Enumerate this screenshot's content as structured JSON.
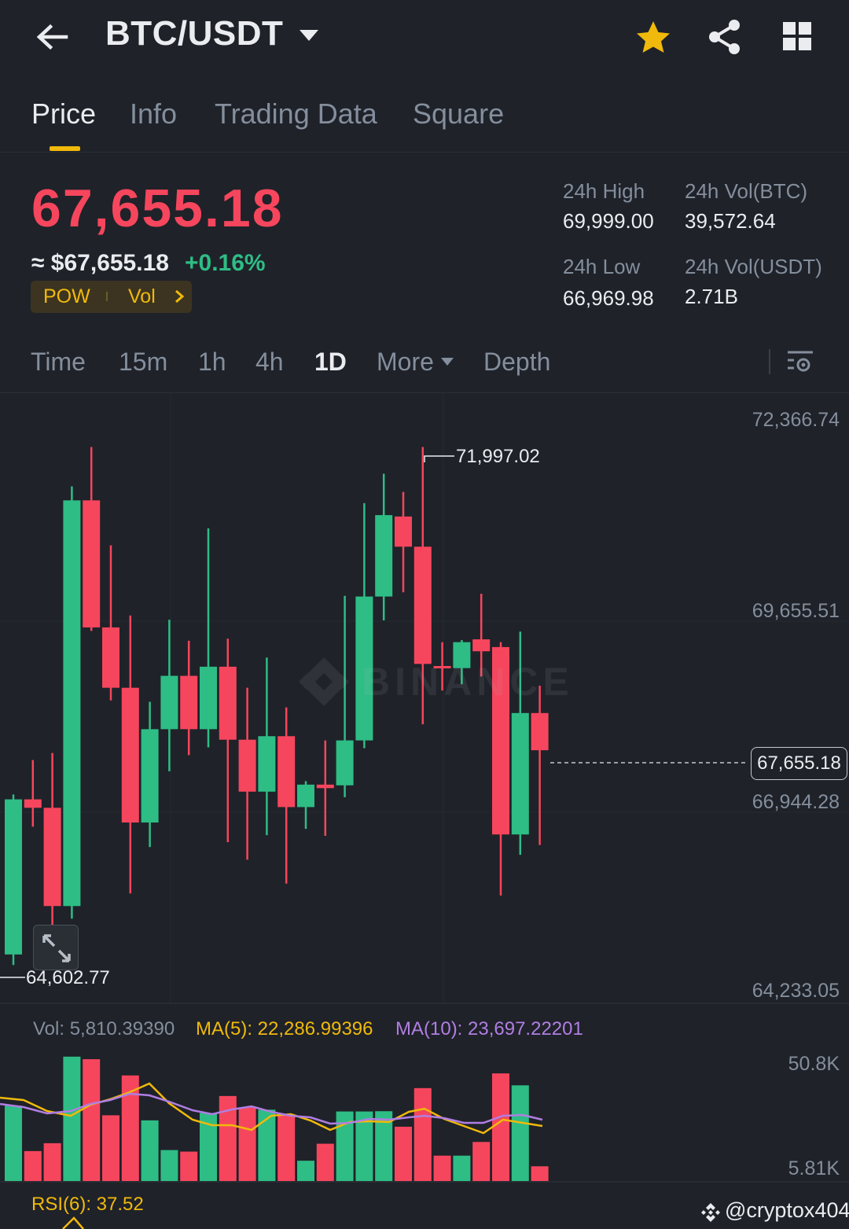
{
  "header": {
    "pair": "BTC/USDT"
  },
  "tabs": [
    "Price",
    "Info",
    "Trading Data",
    "Square"
  ],
  "ticker": {
    "last_price": "67,655.18",
    "fiat_price": "≈ $67,655.18",
    "change_pct": "+0.16%",
    "tag_pow": "POW",
    "tag_vol": "Vol",
    "high_label": "24h High",
    "high_value": "69,999.00",
    "low_label": "24h Low",
    "low_value": "66,969.98",
    "vol_btc_label": "24h Vol(BTC)",
    "vol_btc_value": "39,572.64",
    "vol_usdt_label": "24h Vol(USDT)",
    "vol_usdt_value": "2.71B"
  },
  "intervals": [
    "Time",
    "15m",
    "1h",
    "4h",
    "1D",
    "More",
    "Depth"
  ],
  "chart": {
    "watermark": "BINANCE",
    "axis_labels": [
      "72,366.74",
      "69,655.51",
      "66,944.28",
      "64,233.05"
    ],
    "highest_marker": "71,997.02",
    "lowest_marker": "64,602.77",
    "current_price": "67,655.18"
  },
  "volume": {
    "vol_label": "Vol: 5,810.39390",
    "ma5_label": "MA(5): 22,286.99396",
    "ma10_label": "MA(10): 23,697.22201",
    "axis_top": "50.8K",
    "axis_bottom": "5.81K"
  },
  "rsi": {
    "label": "RSI(6): 37.52"
  },
  "credit": "@cryptox404",
  "colors": {
    "up": "#2ebd85",
    "down": "#f6465d",
    "accent": "#f0b90b",
    "ma10": "#b07ee3"
  },
  "chart_data": {
    "type": "candlestick",
    "y_range": [
      64233.05,
      72366.74
    ],
    "candles": [
      {
        "o": 64750,
        "h": 67030,
        "l": 64600,
        "c": 66960,
        "dir": "up"
      },
      {
        "o": 66960,
        "h": 67520,
        "l": 66570,
        "c": 66840,
        "dir": "down"
      },
      {
        "o": 66840,
        "h": 67620,
        "l": 65130,
        "c": 65440,
        "dir": "down"
      },
      {
        "o": 65440,
        "h": 71420,
        "l": 65260,
        "c": 71220,
        "dir": "up"
      },
      {
        "o": 71220,
        "h": 71980,
        "l": 69360,
        "c": 69410,
        "dir": "down"
      },
      {
        "o": 69410,
        "h": 70580,
        "l": 68370,
        "c": 68550,
        "dir": "down"
      },
      {
        "o": 68550,
        "h": 69580,
        "l": 65620,
        "c": 66630,
        "dir": "down"
      },
      {
        "o": 66630,
        "h": 68350,
        "l": 66280,
        "c": 67960,
        "dir": "up"
      },
      {
        "o": 67960,
        "h": 69520,
        "l": 67360,
        "c": 68720,
        "dir": "up"
      },
      {
        "o": 68720,
        "h": 69220,
        "l": 67590,
        "c": 67960,
        "dir": "down"
      },
      {
        "o": 67960,
        "h": 70820,
        "l": 67700,
        "c": 68850,
        "dir": "up"
      },
      {
        "o": 68850,
        "h": 69250,
        "l": 66350,
        "c": 67810,
        "dir": "down"
      },
      {
        "o": 67810,
        "h": 68550,
        "l": 66100,
        "c": 67070,
        "dir": "down"
      },
      {
        "o": 67070,
        "h": 68980,
        "l": 66450,
        "c": 67860,
        "dir": "up"
      },
      {
        "o": 67860,
        "h": 68270,
        "l": 65760,
        "c": 66850,
        "dir": "down"
      },
      {
        "o": 66850,
        "h": 67220,
        "l": 66540,
        "c": 67170,
        "dir": "up"
      },
      {
        "o": 67170,
        "h": 67800,
        "l": 66440,
        "c": 67120,
        "dir": "down"
      },
      {
        "o": 67160,
        "h": 69860,
        "l": 66990,
        "c": 67800,
        "dir": "up"
      },
      {
        "o": 67800,
        "h": 71180,
        "l": 67690,
        "c": 69850,
        "dir": "up"
      },
      {
        "o": 69850,
        "h": 71600,
        "l": 69510,
        "c": 71010,
        "dir": "up"
      },
      {
        "o": 70990,
        "h": 71340,
        "l": 69910,
        "c": 70560,
        "dir": "down"
      },
      {
        "o": 70560,
        "h": 71980,
        "l": 68030,
        "c": 68890,
        "dir": "down"
      },
      {
        "o": 68860,
        "h": 69200,
        "l": 68510,
        "c": 68860,
        "dir": "down"
      },
      {
        "o": 68830,
        "h": 69230,
        "l": 68600,
        "c": 69200,
        "dir": "up"
      },
      {
        "o": 69240,
        "h": 69890,
        "l": 68710,
        "c": 69070,
        "dir": "down"
      },
      {
        "o": 69130,
        "h": 69200,
        "l": 65590,
        "c": 66460,
        "dir": "down"
      },
      {
        "o": 66460,
        "h": 69350,
        "l": 66170,
        "c": 68190,
        "dir": "up"
      },
      {
        "o": 68190,
        "h": 68580,
        "l": 66310,
        "c": 67660,
        "dir": "down"
      }
    ],
    "volume": {
      "range": [
        5810,
        50800
      ],
      "values": [
        29700,
        11800,
        14900,
        49000,
        48000,
        25900,
        41600,
        23900,
        12200,
        11600,
        26800,
        33500,
        29000,
        28100,
        25900,
        8000,
        14700,
        27400,
        27400,
        27500,
        21400,
        36600,
        10000,
        10000,
        15400,
        42400,
        37700,
        5810
      ],
      "dirs": [
        "up",
        "down",
        "down",
        "up",
        "down",
        "down",
        "down",
        "up",
        "up",
        "down",
        "up",
        "down",
        "down",
        "up",
        "down",
        "up",
        "down",
        "up",
        "up",
        "up",
        "down",
        "down",
        "down",
        "up",
        "down",
        "down",
        "up",
        "down"
      ]
    }
  }
}
